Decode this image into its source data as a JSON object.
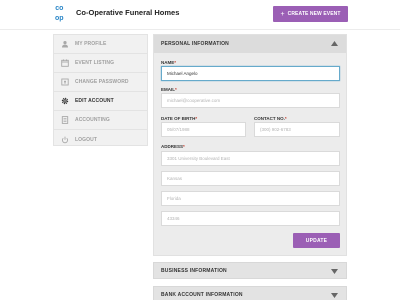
{
  "header": {
    "logo_letters": [
      "co",
      "",
      "op",
      ""
    ],
    "title": "Co-Operative Funeral Homes",
    "create_button": {
      "icon": "plus-icon",
      "label": "CREATE NEW EVENT"
    }
  },
  "sidebar": {
    "items": [
      {
        "label": "MY PROFILE",
        "icon": "user-icon",
        "active": false
      },
      {
        "label": "EVENT LISTING",
        "icon": "calendar-icon",
        "active": false
      },
      {
        "label": "CHANGE PASSWORD",
        "icon": "key-icon",
        "active": false
      },
      {
        "label": "EDIT ACCOUNT",
        "icon": "gear-icon",
        "active": true
      },
      {
        "label": "ACCOUNTING",
        "icon": "document-icon",
        "active": false
      },
      {
        "label": "LOGOUT",
        "icon": "power-icon",
        "active": false
      }
    ]
  },
  "panel": {
    "title": "PERSONAL INFORMATION",
    "name": {
      "label": "NAME",
      "value": "Michael Angelo"
    },
    "email": {
      "label": "EMAIL",
      "placeholder": "michael@cooperative.com"
    },
    "dob": {
      "label": "DATE OF BIRTH",
      "placeholder": "05/07/1988"
    },
    "contact": {
      "label": "CONTACT NO.",
      "placeholder": "(300) 902-6783"
    },
    "address": {
      "label": "ADDRESS",
      "line1_placeholder": "3301 University Boulevard East",
      "line2_placeholder": "Kansas",
      "line3_placeholder": "Florida",
      "line4_placeholder": "43346"
    },
    "update_label": "UPDATE"
  },
  "sections": {
    "business": "BUSINESS INFORMATION",
    "bank": "BANK ACCOUNT INFORMATION"
  },
  "colors": {
    "accent": "#9b5fb5",
    "logo_blue": "#2a86c7",
    "focus_border": "#66aacb"
  }
}
